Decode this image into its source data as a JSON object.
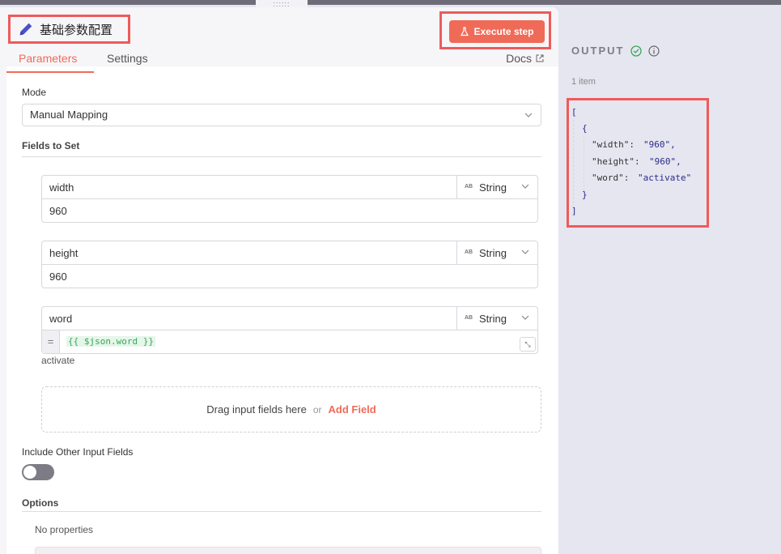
{
  "node": {
    "title": "基础参数配置",
    "execute_label": "Execute step"
  },
  "tabs": [
    {
      "label": "Parameters",
      "active": true
    },
    {
      "label": "Settings",
      "active": false
    }
  ],
  "docs_label": "Docs",
  "mode": {
    "label": "Mode",
    "value": "Manual Mapping"
  },
  "fields_section": {
    "label": "Fields to Set",
    "fields": [
      {
        "name": "width",
        "type_icon": "AB",
        "type": "String",
        "value": "960"
      },
      {
        "name": "height",
        "type_icon": "AB",
        "type": "String",
        "value": "960"
      },
      {
        "name": "word",
        "type_icon": "AB",
        "type": "String",
        "expr_prefix": "=",
        "expression": "{{ $json.word }}",
        "preview": "activate"
      }
    ],
    "dropzone": {
      "text": "Drag input fields here",
      "or": "or",
      "add": "Add Field"
    }
  },
  "include_other": {
    "label": "Include Other Input Fields",
    "enabled": false
  },
  "options": {
    "label": "Options",
    "empty_text": "No properties"
  },
  "output": {
    "title": "OUTPUT",
    "count": "1 item",
    "json_lines": {
      "open_bracket": "[",
      "open_brace": "{",
      "width_key": "\"width\":",
      "width_val": "\"960\",",
      "height_key": "\"height\":",
      "height_val": "\"960\",",
      "word_key": "\"word\":",
      "word_val": "\"activate\"",
      "close_brace": "}",
      "close_bracket": "]"
    }
  },
  "colors": {
    "accent": "#ef6b58",
    "highlight": "#ef5a5a",
    "success": "#3aa65a"
  }
}
